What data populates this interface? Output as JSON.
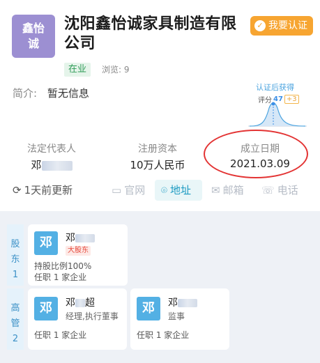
{
  "company": {
    "logo_text": "鑫怡诚",
    "name": "沈阳鑫怡诚家具制造有限公司",
    "status": "在业",
    "views": "浏览: 9",
    "intro_label": "简介:",
    "intro_value": "暂无信息",
    "cert_button": "我要认证"
  },
  "score": {
    "caption": "认证后获得",
    "label": "评分",
    "value": "47",
    "bonus": "+3"
  },
  "fields": {
    "legal_rep_label": "法定代表人",
    "legal_rep_value": "邓",
    "capital_label": "注册资本",
    "capital_value": "10万人民币",
    "founded_label": "成立日期",
    "founded_value": "2021.03.09"
  },
  "actions": {
    "updated": "1天前更新",
    "website": "官网",
    "address": "地址",
    "email": "邮箱",
    "phone": "电话"
  },
  "shareholders": {
    "label": "股东1",
    "items": [
      {
        "avatar": "邓",
        "name": "邓",
        "tag": "大股东",
        "share": "持股比例100%",
        "positions": "任职 1 家企业"
      }
    ]
  },
  "executives": {
    "label": "高管2",
    "items": [
      {
        "avatar": "邓",
        "name": "邓",
        "name_suffix": "超",
        "role": "经理,执行董事",
        "positions": "任职 1 家企业"
      },
      {
        "avatar": "邓",
        "name": "邓",
        "role": "监事",
        "positions": "任职 1 家企业"
      }
    ]
  },
  "colors": {
    "logo_bg": "#9c8fd2",
    "cert_orange": "#f7a531",
    "status_green": "#2f9b57",
    "accent_blue": "#1d9bc2",
    "highlight_red": "#e33333"
  }
}
